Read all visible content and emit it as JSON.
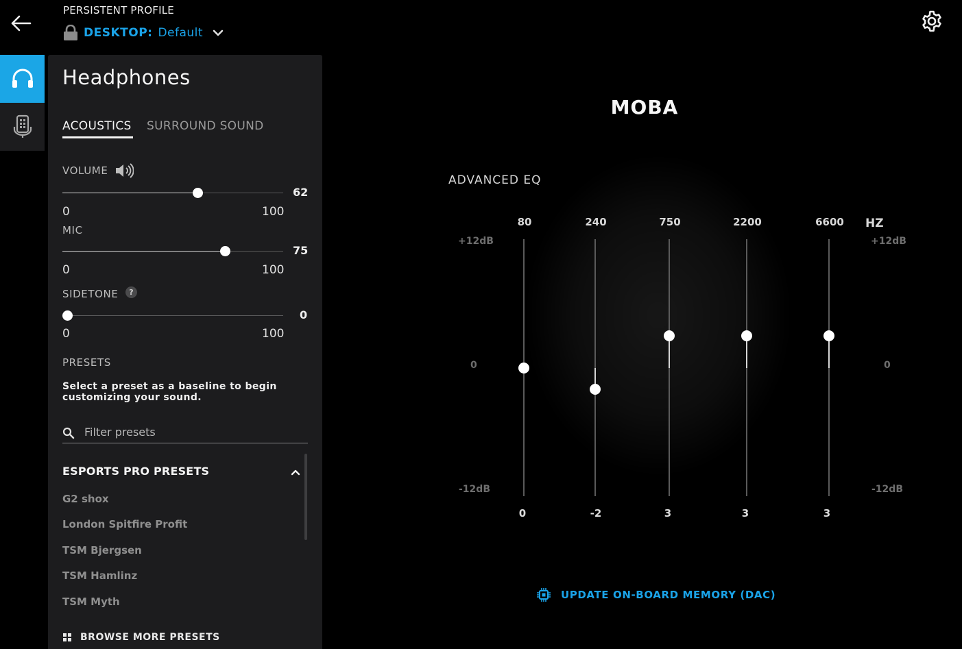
{
  "header": {
    "profile_label": "PERSISTENT PROFILE",
    "profile_prefix": "DESKTOP:",
    "profile_name": "Default"
  },
  "panel": {
    "title": "Headphones",
    "tabs": [
      {
        "label": "ACOUSTICS",
        "active": true
      },
      {
        "label": "SURROUND SOUND",
        "active": false
      }
    ],
    "volume": {
      "label": "VOLUME",
      "value": "62",
      "min": "0",
      "max": "100"
    },
    "mic": {
      "label": "MIC",
      "value": "75",
      "min": "0",
      "max": "100"
    },
    "sidetone": {
      "label": "SIDETONE",
      "help": "?",
      "value": "0",
      "min": "0",
      "max": "100"
    },
    "presets": {
      "label": "PRESETS",
      "description": "Select a preset as a baseline to begin customizing your sound.",
      "filter_placeholder": "Filter presets",
      "group_title": "ESPORTS PRO PRESETS",
      "items": [
        "G2 shox",
        "London Spitfire Profit",
        "TSM Bjergsen",
        "TSM Hamlinz",
        "TSM Myth"
      ],
      "browse_more": "BROWSE MORE PRESETS"
    }
  },
  "eq": {
    "preset_name": "MOBA",
    "title": "ADVANCED EQ",
    "unit": "HZ",
    "db_top": "+12dB",
    "db_mid": "0",
    "db_bottom": "-12dB",
    "bands": [
      {
        "hz": "80",
        "value": 0,
        "value_label": "0"
      },
      {
        "hz": "240",
        "value": -2,
        "value_label": "-2"
      },
      {
        "hz": "750",
        "value": 3,
        "value_label": "3"
      },
      {
        "hz": "2200",
        "value": 3,
        "value_label": "3"
      },
      {
        "hz": "6600",
        "value": 3,
        "value_label": "3"
      }
    ],
    "range": [
      -12,
      12
    ]
  },
  "footer": {
    "update_label": "UPDATE ON-BOARD MEMORY (DAC)"
  },
  "colors": {
    "accent": "#1aa3e8",
    "panel_bg": "#1c1c1e",
    "rail_active": "#1ba6e6"
  },
  "icons": {
    "back": "arrow-left-icon",
    "lock": "lock-icon",
    "dropdown": "chevron-down-icon",
    "settings": "gear-icon",
    "headphones": "headphones-icon",
    "device": "mic-device-icon",
    "speaker": "speaker-icon",
    "search": "search-icon",
    "collapse": "chevron-up-icon",
    "chip": "chip-icon"
  }
}
